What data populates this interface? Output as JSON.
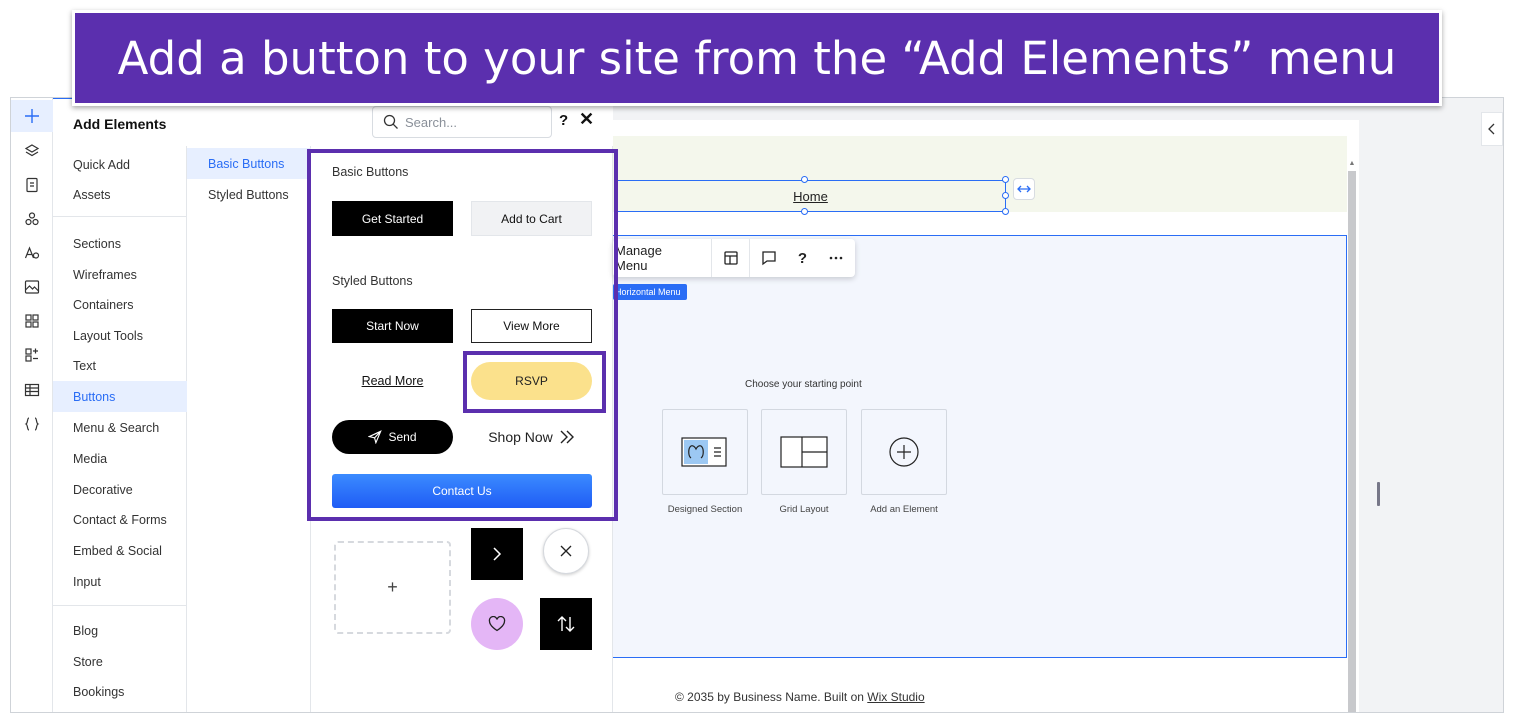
{
  "banner": {
    "text": "Add a button to your site from the “Add Elements” menu"
  },
  "colors": {
    "accent": "#2a6df5",
    "highlight": "#5b2fae",
    "rsvp": "#fbe18c",
    "heart": "#e4b6f6",
    "gradient": [
      "#3b8bff",
      "#1f5cf5"
    ]
  },
  "panel": {
    "title": "Add Elements",
    "search_placeholder": "Search...",
    "help": "?",
    "close": "✕"
  },
  "rail_icons": [
    "add-icon",
    "layers-icon",
    "pages-icon",
    "design-icon",
    "text-theme-icon",
    "media-icon",
    "apps-icon",
    "business-apps-icon",
    "cms-icon",
    "code-icon"
  ],
  "categories": {
    "group1": [
      "Quick Add",
      "Assets"
    ],
    "group2": [
      "Sections",
      "Wireframes",
      "Containers",
      "Layout Tools",
      "Text",
      "Buttons",
      "Menu & Search",
      "Media",
      "Decorative",
      "Contact & Forms",
      "Embed & Social",
      "Input"
    ],
    "group3": [
      "Blog",
      "Store",
      "Bookings"
    ],
    "active": "Buttons"
  },
  "subcategories": [
    "Basic Buttons",
    "Styled Buttons"
  ],
  "gallery": {
    "basic_label": "Basic Buttons",
    "styled_label": "Styled Buttons",
    "get_started": "Get Started",
    "add_to_cart": "Add to Cart",
    "start_now": "Start Now",
    "view_more": "View More",
    "read_more": "Read More",
    "rsvp": "RSVP",
    "send": "Send",
    "shop_now": "Shop Now",
    "contact_us": "Contact Us",
    "add_glyph": "+"
  },
  "canvas": {
    "menu_item": "Home",
    "toolbar_label": "Manage Menu",
    "tag": "Horizontal Menu",
    "start_title": "Choose your starting point",
    "cards": [
      "Designed Section",
      "Grid Layout",
      "Add an Element"
    ],
    "footer_prefix": "© 2035 by Business Name. Built on ",
    "footer_link": "Wix Studio"
  }
}
